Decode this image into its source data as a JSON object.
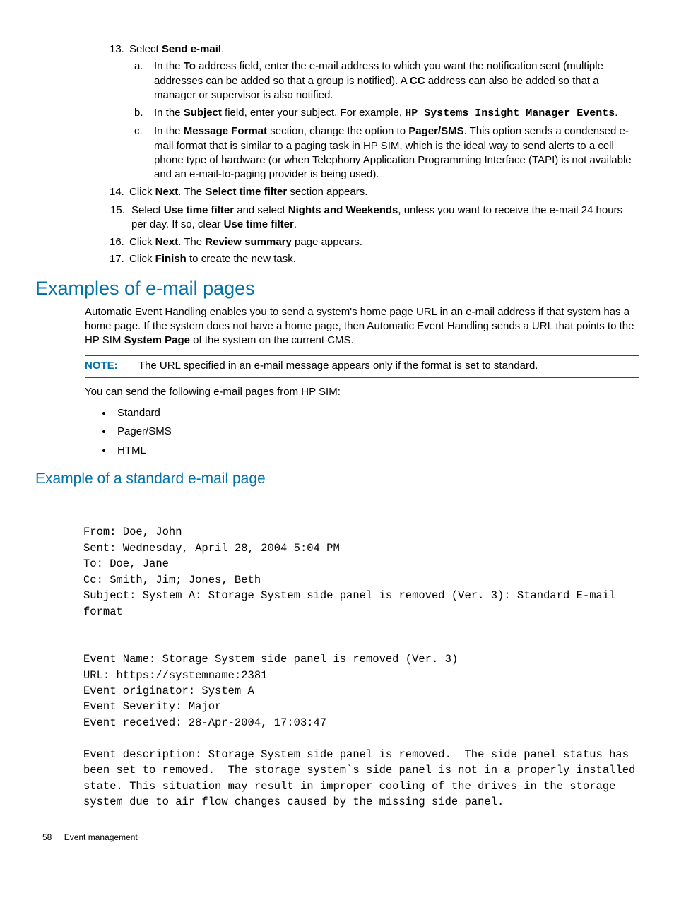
{
  "steps": {
    "s13": {
      "num": "13.",
      "pre": "Select ",
      "b1": "Send e-mail",
      "post": "."
    },
    "s13a": {
      "letter": "a.",
      "t1": "In the ",
      "b1": "To",
      "t2": " address field, enter the e-mail address to which you want the notification sent (multiple addresses can be added so that a group is notified). A ",
      "b2": "CC",
      "t3": " address can also be added so that a manager or supervisor is also notified."
    },
    "s13b": {
      "letter": "b.",
      "t1": "In the ",
      "b1": "Subject",
      "t2": " field, enter your subject. For example, ",
      "m1": "HP Systems Insight Manager Events",
      "t3": "."
    },
    "s13c": {
      "letter": "c.",
      "t1": "In the ",
      "b1": "Message Format",
      "t2": " section, change the option to ",
      "b2": "Pager/SMS",
      "t3": ". This option sends a condensed e-mail format that is similar to a paging task in HP SIM, which is the ideal way to send alerts to a cell phone type of hardware (or when Telephony Application Programming Interface (TAPI) is not available and an e-mail-to-paging provider is being used)."
    },
    "s14": {
      "num": "14.",
      "t1": "Click ",
      "b1": "Next",
      "t2": ". The ",
      "b2": "Select time filter",
      "t3": " section appears."
    },
    "s15": {
      "num": "15.",
      "t1": "Select ",
      "b1": "Use time filter",
      "t2": " and select ",
      "b2": "Nights and Weekends",
      "t3": ", unless you want to receive the e-mail 24 hours per day. If so, clear ",
      "b3": "Use time filter",
      "t4": "."
    },
    "s16": {
      "num": "16.",
      "t1": "Click ",
      "b1": "Next",
      "t2": ". The ",
      "b2": "Review summary",
      "t3": " page appears."
    },
    "s17": {
      "num": "17.",
      "t1": "Click ",
      "b1": "Finish",
      "t2": " to create the new task."
    }
  },
  "h2": "Examples of e-mail pages",
  "intro": {
    "t1": "Automatic Event Handling enables you to send a system's home page URL in an e-mail address if that system has a home page. If the system does not have a home page, then Automatic Event Handling sends a URL that points to the HP SIM ",
    "b1": "System Page",
    "t2": " of the system on the current CMS."
  },
  "note": {
    "label": "NOTE:",
    "text": "The URL specified in an e-mail message appears only if the format is set to standard."
  },
  "listIntro": "You can send the following e-mail pages from HP SIM:",
  "bullets": [
    "Standard",
    "Pager/SMS",
    "HTML"
  ],
  "h3": "Example of a standard e-mail page",
  "email": "From: Doe, John\nSent: Wednesday, April 28, 2004 5:04 PM\nTo: Doe, Jane\nCc: Smith, Jim; Jones, Beth\nSubject: System A: Storage System side panel is removed (Ver. 3): Standard E-mail format\n\n\nEvent Name: Storage System side panel is removed (Ver. 3)\nURL: https://systemname:2381\nEvent originator: System A\nEvent Severity: Major\nEvent received: 28-Apr-2004, 17:03:47\n\nEvent description: Storage System side panel is removed.  The side panel status has been set to removed.  The storage system`s side panel is not in a properly installed state. This situation may result in improper cooling of the drives in the storage system due to air flow changes caused by the missing side panel.",
  "footer": {
    "page": "58",
    "title": "Event management"
  }
}
